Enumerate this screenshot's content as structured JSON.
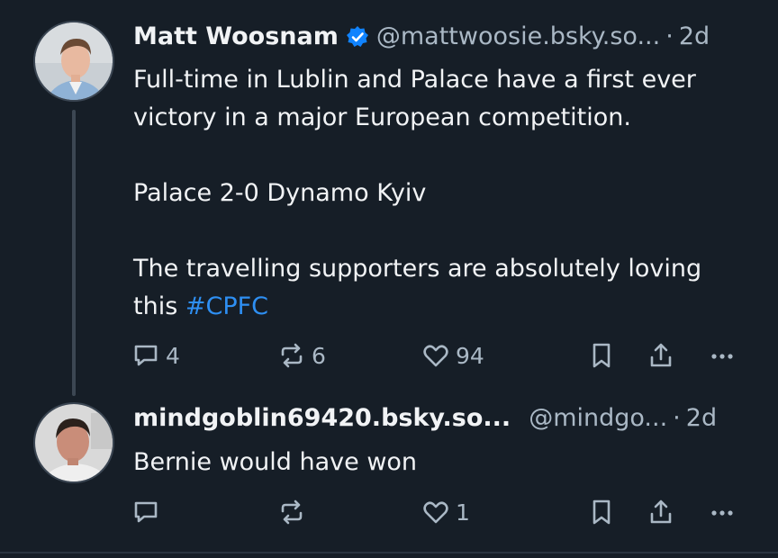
{
  "post1": {
    "author_name": "Matt Woosnam",
    "handle": "@mattwoosie.bsky.so...",
    "separator": "·",
    "time": "2d",
    "text_line1": "Full-time in Lublin and Palace have a first ever",
    "text_line2": "victory in a major European competition.",
    "text_line3": "Palace 2-0 Dynamo Kyiv",
    "text_line4": "The travelling supporters are absolutely loving",
    "text_line5_prefix": "this",
    "hashtag": "#CPFC",
    "replies": "4",
    "reposts": "6",
    "likes": "94"
  },
  "post2": {
    "author_name": "mindgoblin69420.bsky.so...",
    "handle": "@mindgo...",
    "separator": "·",
    "time": "2d",
    "text": "Bernie would have won",
    "replies": "",
    "reposts": "",
    "likes": "1"
  },
  "colors": {
    "background": "#161e27",
    "text": "#f1f3f5",
    "muted": "#aab8c5",
    "link": "#2e8ff2",
    "verified": "#1083fe"
  },
  "icons": [
    "reply-icon",
    "repost-icon",
    "like-icon",
    "bookmark-icon",
    "share-icon",
    "more-icon",
    "verified-icon"
  ]
}
